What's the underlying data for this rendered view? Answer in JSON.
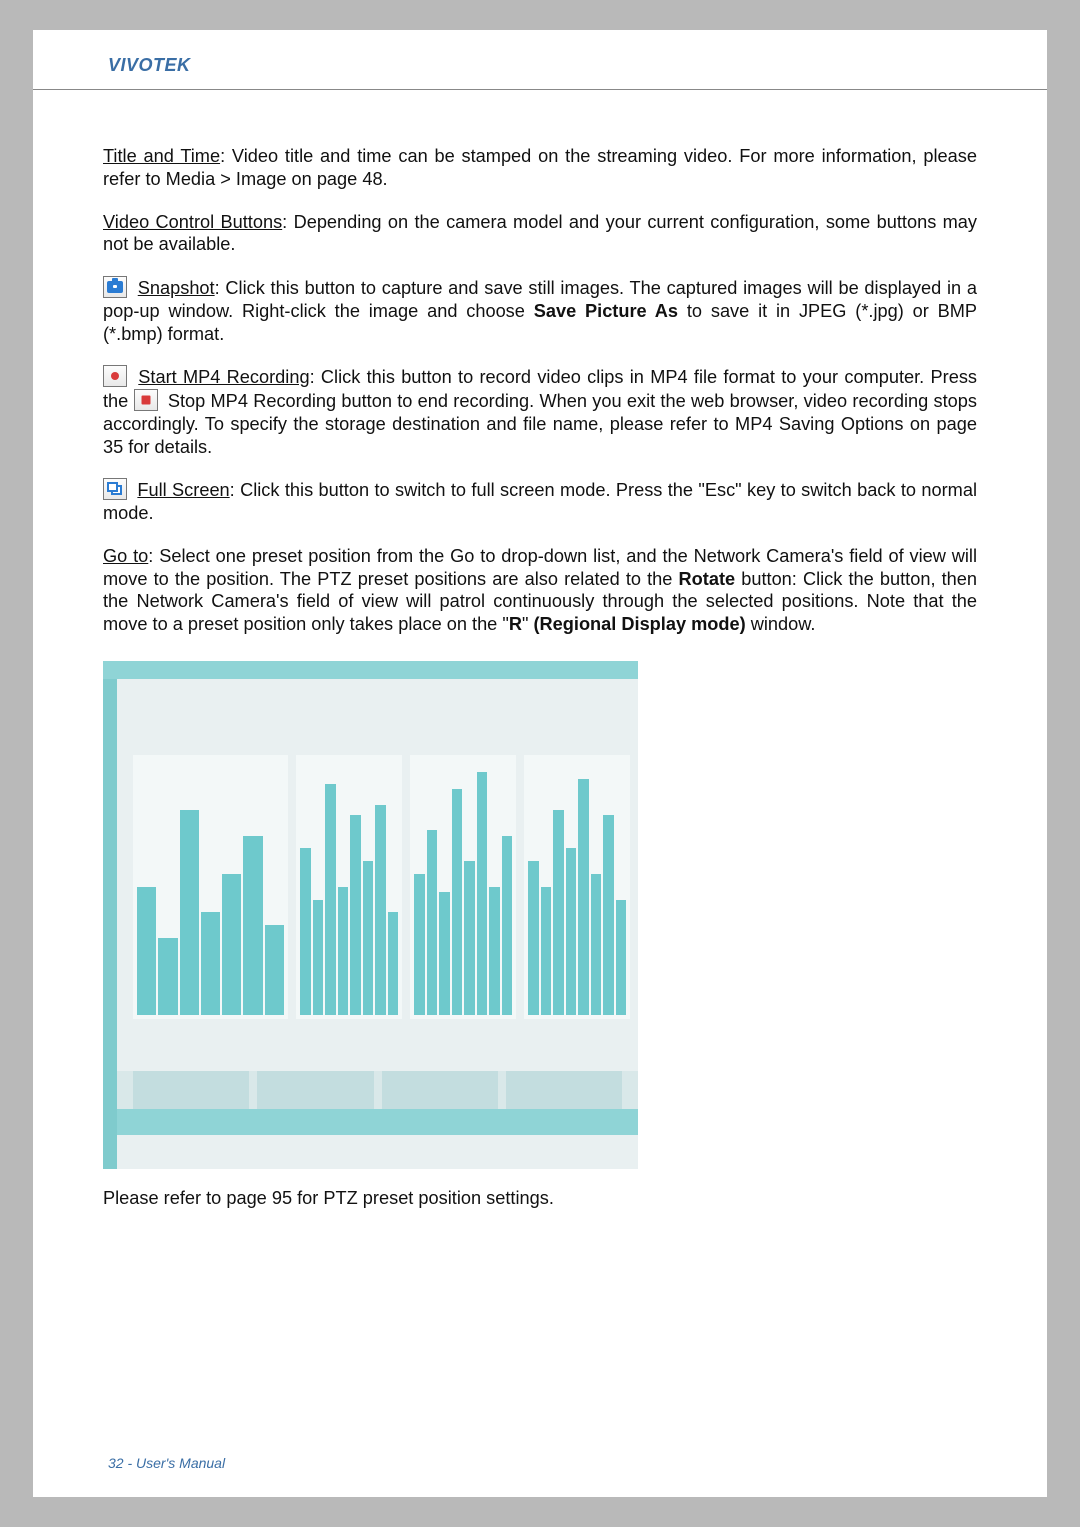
{
  "header": {
    "brand": "VIVOTEK"
  },
  "sections": {
    "titleTime": {
      "label": "Title and Time",
      "text": ": Video title and time can be stamped on the streaming video. For more information, please refer to Media > Image on page 48."
    },
    "videoControl": {
      "label": "Video Control Buttons",
      "text": ": Depending on the camera model and your current configuration, some buttons may not be available."
    },
    "snapshot": {
      "label": "Snapshot",
      "pre": ": Click this button to capture and save still images. The captured images will be displayed in a pop-up window. Right-click the image and choose ",
      "bold": "Save Picture As",
      "post": " to save it in JPEG (*.jpg) or BMP (*.bmp) format."
    },
    "startRec": {
      "label": "Start MP4 Recording",
      "pre": ": Click this button to record video clips in MP4 file format to your computer. Press the ",
      "post": " Stop MP4 Recording button to end recording. When you exit the web browser, video recording stops accordingly. To specify the storage destination and file name, please refer to MP4 Saving Options on page 35 for details."
    },
    "fullscreen": {
      "label": "Full Screen",
      "text": ": Click this button to switch to full screen mode. Press the \"Esc\" key to switch back to normal mode."
    },
    "goto": {
      "label": "Go to",
      "pre": ": Select one preset position from the Go to drop-down list, and the Network Camera's field of view will move to the position. The PTZ preset positions are also related to the ",
      "bold1": "Rotate",
      "mid": " button: Click the button, then the Network Camera's field of view will patrol continuously through the selected positions. Note that the move to a preset position only takes place on the \"",
      "bold2": "R",
      "mid2": "\" ",
      "bold3": "(Regional Display mode)",
      "post": " window."
    },
    "closing": "Please refer to page 95 for PTZ preset position settings."
  },
  "footer": {
    "page": "32",
    "sep": " - ",
    "title": "User's Manual"
  }
}
